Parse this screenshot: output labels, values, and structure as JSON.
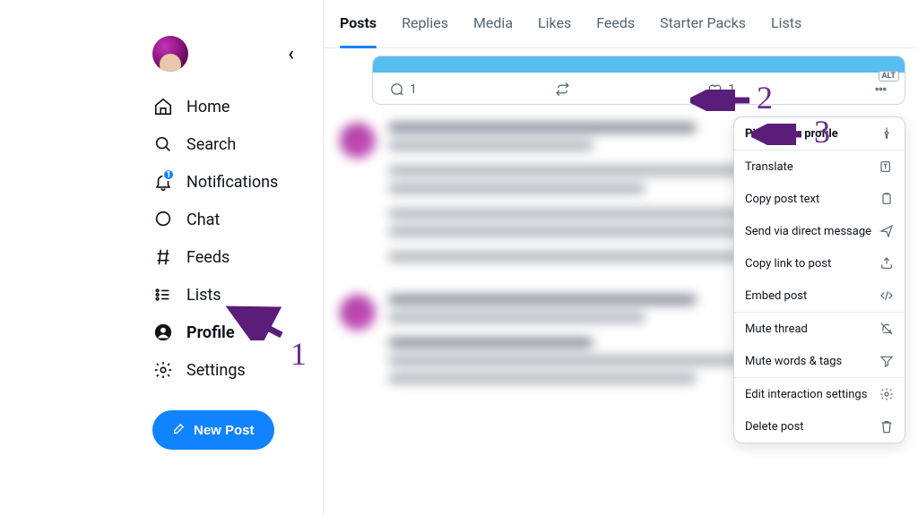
{
  "sidebar": {
    "items": [
      {
        "key": "home",
        "label": "Home"
      },
      {
        "key": "search",
        "label": "Search"
      },
      {
        "key": "notifications",
        "label": "Notifications",
        "badge": "1"
      },
      {
        "key": "chat",
        "label": "Chat"
      },
      {
        "key": "feeds",
        "label": "Feeds"
      },
      {
        "key": "lists",
        "label": "Lists"
      },
      {
        "key": "profile",
        "label": "Profile",
        "active": true
      },
      {
        "key": "settings",
        "label": "Settings"
      }
    ],
    "new_post_label": "New Post"
  },
  "tabs": [
    {
      "label": "Posts",
      "active": true
    },
    {
      "label": "Replies"
    },
    {
      "label": "Media"
    },
    {
      "label": "Likes"
    },
    {
      "label": "Feeds"
    },
    {
      "label": "Starter Packs"
    },
    {
      "label": "Lists"
    }
  ],
  "mini_card": {
    "alt_badge": "ALT",
    "reply_count": "1",
    "like_count": "1"
  },
  "context_menu": [
    {
      "label": "Pin to your profile",
      "icon": "pin",
      "bold": true
    },
    {
      "sep": true
    },
    {
      "label": "Translate",
      "icon": "translate"
    },
    {
      "label": "Copy post text",
      "icon": "clipboard"
    },
    {
      "label": "Send via direct message",
      "icon": "send"
    },
    {
      "label": "Copy link to post",
      "icon": "share"
    },
    {
      "label": "Embed post",
      "icon": "code"
    },
    {
      "sep": true
    },
    {
      "label": "Mute thread",
      "icon": "mute"
    },
    {
      "label": "Mute words & tags",
      "icon": "filter"
    },
    {
      "sep": true
    },
    {
      "label": "Edit interaction settings",
      "icon": "gear"
    },
    {
      "label": "Delete post",
      "icon": "trash"
    }
  ],
  "annotations": {
    "1": "1",
    "2": "2",
    "3": "3"
  }
}
